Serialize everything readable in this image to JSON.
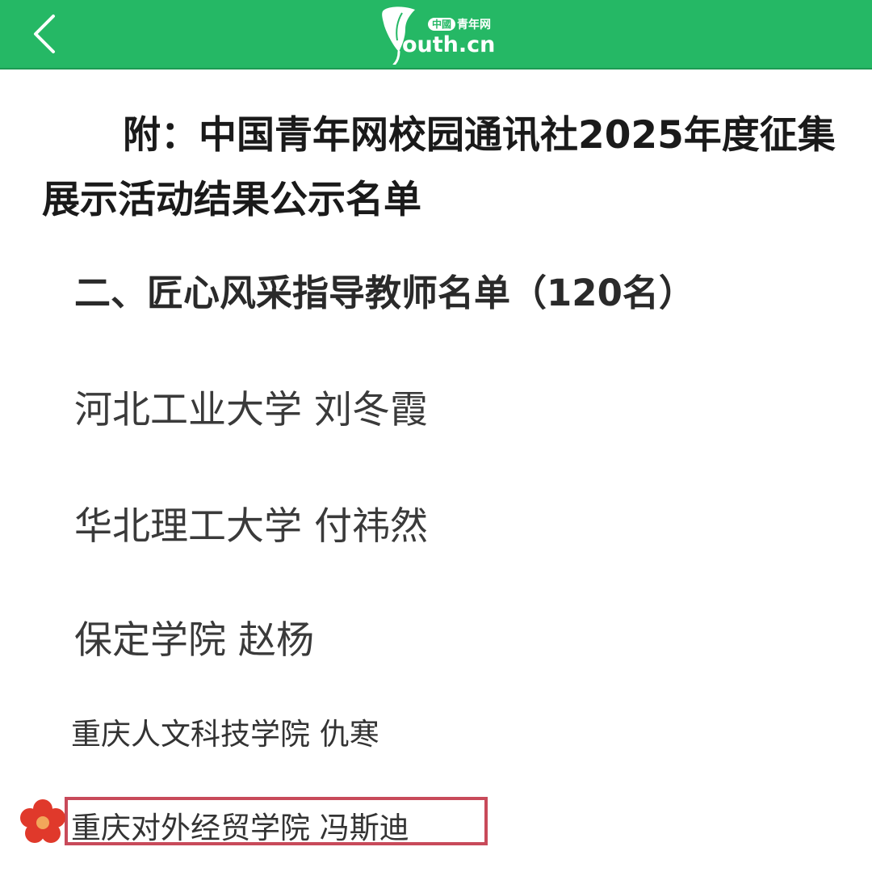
{
  "header": {
    "logo_badge": "中國",
    "logo_site_cn": "青年网",
    "logo_text": "outh.cn",
    "accent_color": "#25b865",
    "back_icon": "chevron-left-icon",
    "logo_icon": "ginkgo-leaf-icon"
  },
  "article": {
    "title": "附：中国青年网校园通讯社2025年度征集展示活动结果公示名单",
    "section_heading": "二、匠心风采指导教师名单（120名）",
    "entries": [
      "河北工业大学 刘冬霞",
      "华北理工大学 付祎然",
      "保定学院 赵杨",
      "重庆人文科技学院 仇寒",
      "重庆对外经贸学院 冯斯迪"
    ],
    "highlight_color": "#c84a5a",
    "marker_icon": "red-flower-icon"
  }
}
